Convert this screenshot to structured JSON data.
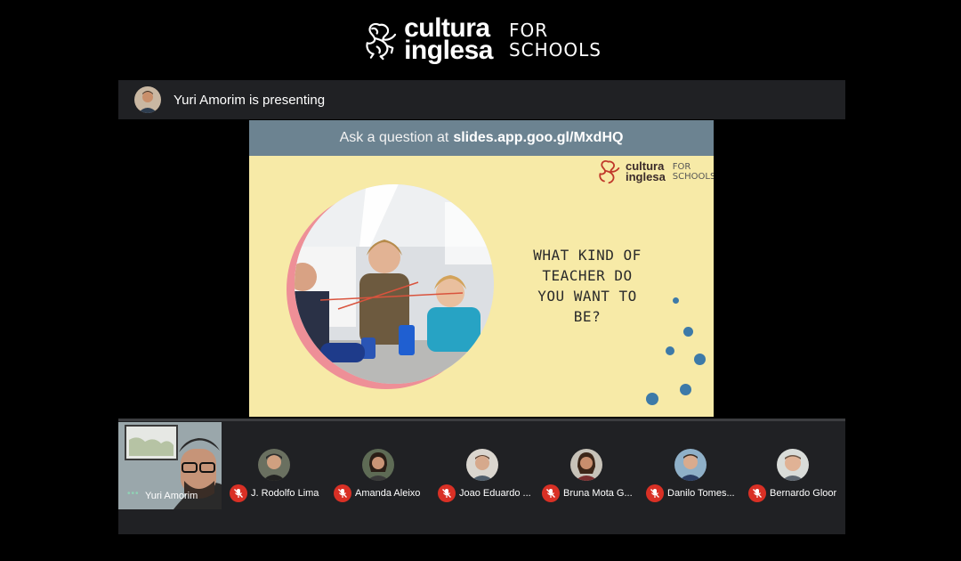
{
  "brand": {
    "name_line1": "cultura",
    "name_line2": "inglesa",
    "for_line1": "FOR",
    "for_line2": "SCHOOLS"
  },
  "presenting": {
    "text": "Yuri Amorim is presenting"
  },
  "slide": {
    "header_prefix": "Ask a question at",
    "header_link": "slides.app.goo.gl/MxdHQ",
    "logo": {
      "name_line1": "cultura",
      "name_line2": "inglesa",
      "for_line1": "FOR",
      "for_line2": "SCHOOLS"
    },
    "question_lines": [
      "WHAT KIND OF",
      "TEACHER DO",
      "YOU WANT TO",
      "BE?"
    ]
  },
  "self": {
    "name": "Yuri Amorim"
  },
  "participants": [
    {
      "name": "J. Rodolfo Lima",
      "muted": true
    },
    {
      "name": "Amanda Aleixo",
      "muted": true
    },
    {
      "name": "Joao Eduardo ...",
      "muted": true
    },
    {
      "name": "Bruna Mota G...",
      "muted": true
    },
    {
      "name": "Danilo Tomes...",
      "muted": true
    },
    {
      "name": "Bernardo Gloor",
      "muted": true
    }
  ],
  "colors": {
    "mute_red": "#d93025",
    "slide_bg": "#f7eaa7",
    "slide_header": "#6c8391",
    "dot_blue": "#3d7aa8",
    "ring_pink": "#ee8f97"
  }
}
